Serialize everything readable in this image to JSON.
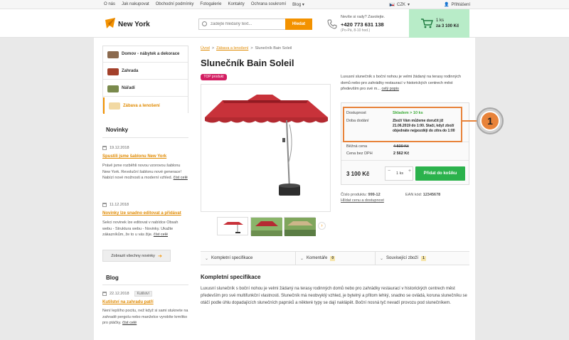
{
  "topbar": {
    "nav": [
      "O nás",
      "Jak nakupovat",
      "Obchodní podmínky",
      "Fotogalerie",
      "Kontakty",
      "Ochrana soukromí",
      "Blog"
    ],
    "currency": "CZK",
    "login": "Přihlášení"
  },
  "header": {
    "logo_text": "New York",
    "search_placeholder": "zadejte hledaný text...",
    "search_button": "Hledat",
    "phone_intro": "Nevíte si rady? Zavolejte.",
    "phone_number": "+420 773 631 138",
    "phone_hours": "(Po-Pá, 8-10 hod.)",
    "cart_count": "1 ks",
    "cart_total": "za 3 100 Kč"
  },
  "sidebar": {
    "categories": [
      "Domov - nábytek a dekorace",
      "Zahrada",
      "Nářadí",
      "Zábava a lenošení"
    ],
    "news_title": "Novinky",
    "news": [
      {
        "date": "19.12.2018",
        "title": "Spustili jsme šablonu New York",
        "text": "Právě jsme rozběhli novou vzorovou šablonu New York. Revoluční šablonu nové generace! Nabízí nové možnosti a moderní vzhled.",
        "more": "číst celé"
      },
      {
        "date": "11.12.2018",
        "title": "Novinky lze snadno editovat a přidávat",
        "text": "Sekci novinek lze editovat v nabídce Obsah webu - Struktura webu - Novinky. Ukažte zákazníkům, že to u vás žije.",
        "more": "číst celé"
      }
    ],
    "news_all_button": "Zobrazit všechny novinky",
    "blog_title": "Blog",
    "blog": [
      {
        "date": "22.12.2018",
        "tag": "Kutilství",
        "title": "Kutilství na zahradu patří",
        "text": "Není lepšího pocitu, než když si sami stuknete na zahradě pergolu nebo manželce vyrobíte krmítko pro ptáčky.",
        "more": "číst celé"
      }
    ]
  },
  "product": {
    "breadcrumb": [
      "Úvod",
      "Zábava a lenošení",
      "Slunečník Bain Soleil"
    ],
    "title": "Slunečník Bain Soleil",
    "badge": "TOP produkt",
    "short_desc": "Luxusní slunečník s boční nohou je velmi žádaný na terasy rodinných domů nebo pro zahrádky restaurací v historických centrech měst především pro své m...",
    "short_more": "celý popis",
    "availability_label": "Dostupnost",
    "availability_value": "Skladem > 10 ks",
    "delivery_label": "Doba dodání",
    "delivery_value": "Zboží Vám můžeme doručit již 21.06.2019 do 1:00. Stačí, když zboží objednáte nejpozději do zítra do 1:00",
    "regular_label": "Běžná cena",
    "regular_value": "4 500 Kč",
    "novat_label": "Cena bez DPH",
    "novat_value": "2 562 Kč",
    "price": "3 100 Kč",
    "qty_value": "1",
    "qty_unit": "ks",
    "qty_minus": "−",
    "qty_plus": "+",
    "add_button": "Přidat do košíku",
    "code_label": "Číslo produktu:",
    "code_value": "999-12",
    "ean_label": "EAN kód:",
    "ean_value": "12345678",
    "availability_link": "Hlídat cenu a dostupnost",
    "callout_number": "1"
  },
  "tabs": [
    {
      "label": "Kompletní specifikace",
      "count": ""
    },
    {
      "label": "Komentáře",
      "count": "0"
    },
    {
      "label": "Související zboží",
      "count": "1"
    }
  ],
  "spec": {
    "title": "Kompletní specifikace",
    "text": "Luxusní slunečník s boční nohou je velmi žádaný na terasy rodinných domů nebo pro zahrádky restaurací v historických centrech měst především pro své multifunkční vlastnosti. Slunečník má neobvyklý vzhled, je bytelný a přitom lehký, snadno se ovládá, koruna slunečníku se otáčí podle úhlu dopadajících slunečních paprsků a některé typy se dají naklápět. Boční nosná tyč nevadí provozu pod slunečníkem."
  },
  "colors": {
    "accent": "#f39200",
    "badge": "#d31e62",
    "cart_bg": "#b8ecc8",
    "stock_green": "#3aaa35",
    "callout": "#e8833a",
    "button_green": "#2bb24c"
  }
}
